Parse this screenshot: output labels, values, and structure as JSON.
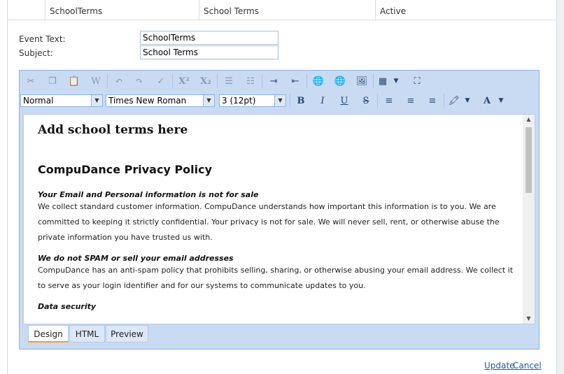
{
  "grid_row": {
    "cells": [
      "",
      "SchoolTerms",
      "School Terms",
      "Active"
    ]
  },
  "form": {
    "event_text_label": "Event Text:",
    "event_text_value": "SchoolTerms",
    "subject_label": "Subject:",
    "subject_value": "School Terms"
  },
  "toolbar": {
    "row1_icons": [
      "cut-icon",
      "copy-icon",
      "paste-icon",
      "paste-from-word-icon",
      "undo-icon",
      "redo-icon",
      "spellcheck-icon",
      "superscript-icon",
      "subscript-icon",
      "numbered-list-icon",
      "bulleted-list-icon",
      "indent-icon",
      "outdent-icon",
      "insert-link-icon",
      "remove-link-icon",
      "insert-image-icon",
      "insert-table-icon",
      "fullscreen-icon"
    ],
    "paragraph_style": "Normal",
    "font_name": "Times New Roman",
    "font_size": "3 (12pt)",
    "bold": "B",
    "italic": "I",
    "underline": "U",
    "strikethrough": "S",
    "font_color": "A"
  },
  "content": {
    "heading": "Add school terms here",
    "policy_title": "CompuDance Privacy Policy",
    "section1_title": "Your Email and Personal information is not for sale",
    "section1_lines": [
      "We collect standard customer information. CompuDance understands how important this information is to you. We are",
      "committed to keeping it strictly confidential. Your privacy is not for sale. We will never sell, rent, or otherwise abuse the",
      "private information you have trusted us with."
    ],
    "section2_title": "We do not SPAM or sell your email addresses",
    "section2_lines": [
      "CompuDance has an anti-spam policy that prohibits selling, sharing, or otherwise abusing your email address. We collect it",
      "to serve as your login identifier and for our systems to communicate updates to you."
    ],
    "section3_title": "Data security"
  },
  "tabs": [
    "Design",
    "HTML",
    "Preview"
  ],
  "actions": {
    "update": "Update",
    "cancel": "Cancel"
  },
  "colors": {
    "accent": "#f0a030",
    "toolbar_bg": "#c9daf3",
    "link": "#1a5aa6"
  }
}
